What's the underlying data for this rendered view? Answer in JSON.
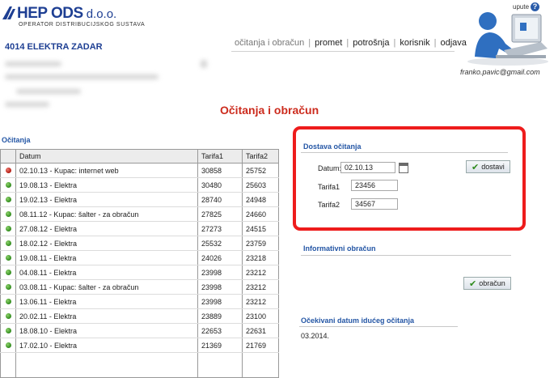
{
  "header": {
    "logo_main": "HEP ODS",
    "logo_suffix": "d.o.o.",
    "logo_sub": "OPERATOR DISTRIBUCIJSKOG SUSTAVA",
    "company": "4014 ELEKTRA ZADAR",
    "help_label": "upute",
    "help_icon": "?",
    "user_email": "franko.pavic@gmail.com"
  },
  "nav": {
    "items": [
      "očitanja i obračun",
      "promet",
      "potrošnja",
      "korisnik",
      "odjava"
    ]
  },
  "page_title": "Očitanja i obračun",
  "readings": {
    "section_title": "Očitanja",
    "columns": [
      "Datum",
      "Tarifa1",
      "Tarifa2"
    ],
    "rows": [
      {
        "status": "red",
        "date": "02.10.13 - Kupac: internet web",
        "t1": "30858",
        "t2": "25752"
      },
      {
        "status": "green",
        "date": "19.08.13 - Elektra",
        "t1": "30480",
        "t2": "25603"
      },
      {
        "status": "green",
        "date": "19.02.13 - Elektra",
        "t1": "28740",
        "t2": "24948"
      },
      {
        "status": "green",
        "date": "08.11.12 - Kupac: šalter - za obračun",
        "t1": "27825",
        "t2": "24660"
      },
      {
        "status": "green",
        "date": "27.08.12 - Elektra",
        "t1": "27273",
        "t2": "24515"
      },
      {
        "status": "green",
        "date": "18.02.12 - Elektra",
        "t1": "25532",
        "t2": "23759"
      },
      {
        "status": "green",
        "date": "19.08.11 - Elektra",
        "t1": "24026",
        "t2": "23218"
      },
      {
        "status": "green",
        "date": "04.08.11 - Elektra",
        "t1": "23998",
        "t2": "23212"
      },
      {
        "status": "green",
        "date": "03.08.11 - Kupac: šalter - za obračun",
        "t1": "23998",
        "t2": "23212"
      },
      {
        "status": "green",
        "date": "13.06.11 - Elektra",
        "t1": "23998",
        "t2": "23212"
      },
      {
        "status": "green",
        "date": "20.02.11 - Elektra",
        "t1": "23889",
        "t2": "23100"
      },
      {
        "status": "green",
        "date": "18.08.10 - Elektra",
        "t1": "22653",
        "t2": "22631"
      },
      {
        "status": "green",
        "date": "17.02.10 - Elektra",
        "t1": "21369",
        "t2": "21769"
      }
    ]
  },
  "dostava": {
    "title": "Dostava očitanja",
    "date_label": "Datum:",
    "date_value": "02.10.13",
    "tarifa1_label": "Tarifa1",
    "tarifa1_value": "23456",
    "tarifa2_label": "Tarifa2",
    "tarifa2_value": "34567",
    "submit_label": "dostavi"
  },
  "informativni": {
    "title": "Informativni obračun",
    "button_label": "obračun"
  },
  "next_reading": {
    "title": "Očekivani datum idućeg očitanja",
    "value": "03.2014."
  },
  "colors": {
    "brand_blue": "#1e3f93",
    "title_red": "#cc2b1d",
    "highlight_red": "#ee1c1c",
    "status_green": "#2f8a1c",
    "status_red": "#b11a10"
  }
}
